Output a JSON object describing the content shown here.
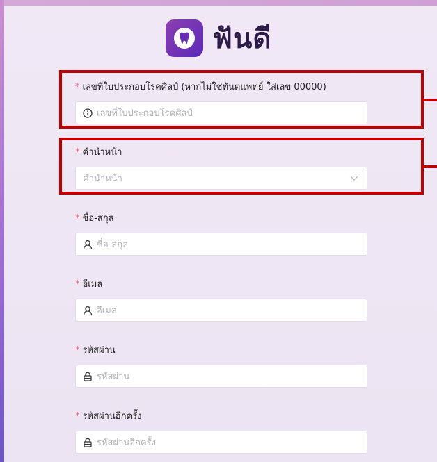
{
  "brand": {
    "name": "ฟันดี",
    "icon": "tooth-icon",
    "accent": "#7a36b6"
  },
  "form": {
    "license": {
      "label": "เลขที่ใบประกอบโรคศิลป์ (หากไม่ใช่ทันตแพทย์ ใส่เลข 00000)",
      "placeholder": "เลขที่ใบประกอบโรคศิลป์",
      "icon": "info-icon"
    },
    "prefix": {
      "label": "คำนำหน้า",
      "placeholder": "คำนำหน้า",
      "icon": "chevron-down-icon"
    },
    "fullname": {
      "label": "ชื่อ-สกุล",
      "placeholder": "ชื่อ-สกุล",
      "icon": "user-icon"
    },
    "email": {
      "label": "อีเมล",
      "placeholder": "อีเมล",
      "icon": "user-icon"
    },
    "password": {
      "label": "รหัสผ่าน",
      "placeholder": "รหัสผ่าน",
      "icon": "lock-icon"
    },
    "confirm_password": {
      "label": "รหัสผ่านอีกครั้ง",
      "placeholder": "รหัสผ่านอีกครั้ง",
      "icon": "lock-icon"
    },
    "required_mark": "*"
  },
  "colors": {
    "required": "#ef5f7a",
    "highlight": "#c00000"
  }
}
